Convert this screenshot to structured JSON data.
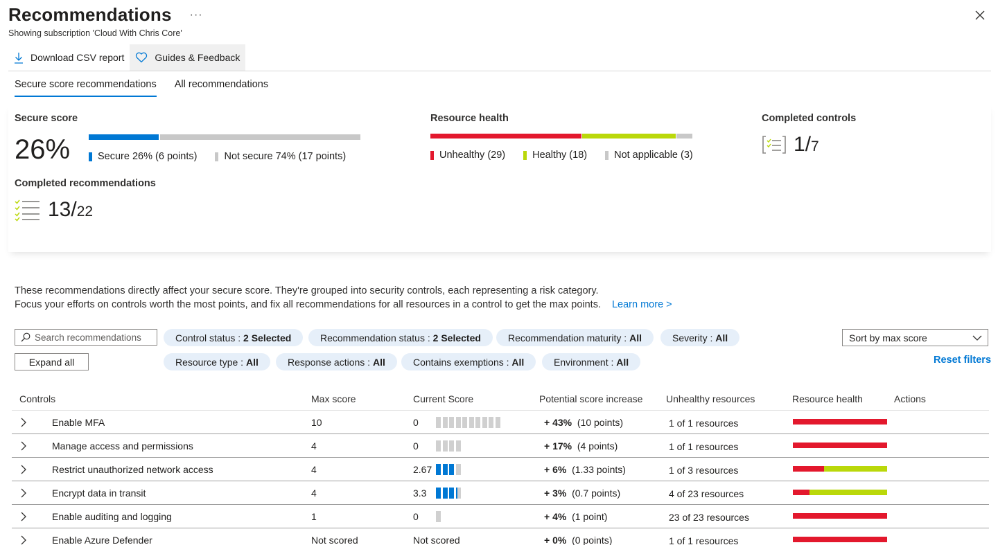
{
  "header": {
    "title": "Recommendations",
    "more": "···",
    "subtitle": "Showing subscription 'Cloud With Chris Core'"
  },
  "toolbar": {
    "download_label": "Download CSV report",
    "guides_label": "Guides & Feedback"
  },
  "tabs": [
    {
      "label": "Secure score recommendations",
      "selected": true
    },
    {
      "label": "All recommendations",
      "selected": false
    }
  ],
  "colors": {
    "accent": "#0078d4",
    "unhealthy": "#e3182d",
    "healthy": "#bad80a",
    "neutral": "#c8c8c8",
    "pill": "#e6eff9"
  },
  "secure_score": {
    "label": "Secure score",
    "value": "26%",
    "secure_fraction": 0.26,
    "secure_label": "Secure 26% (6 points)",
    "not_secure_label": "Not secure 74% (17 points)"
  },
  "resource_health": {
    "label": "Resource health",
    "unhealthy": 29,
    "healthy": 18,
    "not_applicable": 3,
    "unhealthy_label": "Unhealthy (29)",
    "healthy_label": "Healthy (18)",
    "na_label": "Not applicable (3)"
  },
  "completed_controls": {
    "label": "Completed controls",
    "num": "1",
    "den": "7"
  },
  "completed_recommendations": {
    "label": "Completed recommendations",
    "num": "13",
    "den": "22"
  },
  "description": {
    "line1": "These recommendations directly affect your secure score. They're grouped into security controls, each representing a risk category.",
    "line2": "Focus your efforts on controls worth the most points, and fix all recommendations for all resources in a control to get the max points.",
    "learn_more": "Learn more >"
  },
  "filters": {
    "search_placeholder": "Search recommendations",
    "expand_all": "Expand all",
    "sort_value": "Sort by max score",
    "reset": "Reset filters",
    "pills": [
      {
        "key": "Control status : ",
        "value": "2 Selected"
      },
      {
        "key": "Recommendation status : ",
        "value": "2 Selected"
      },
      {
        "key": "Recommendation maturity : ",
        "value": "All"
      },
      {
        "key": "Severity : ",
        "value": "All"
      },
      {
        "key": "Resource type : ",
        "value": "All"
      },
      {
        "key": "Response actions : ",
        "value": "All"
      },
      {
        "key": "Contains exemptions : ",
        "value": "All"
      },
      {
        "key": "Environment : ",
        "value": "All"
      }
    ]
  },
  "table": {
    "columns": [
      "Controls",
      "Max score",
      "Current Score",
      "Potential score increase",
      "Unhealthy resources",
      "Resource health",
      "Actions"
    ],
    "rows": [
      {
        "name": "Enable MFA",
        "max": "10",
        "current": "0",
        "segments": 10,
        "filled": 0,
        "partial": 0,
        "inc_pct": "+ 43%",
        "inc_pts": "(10 points)",
        "unhealthy": "1 of 1 resources",
        "health_unhealthy": 1.0
      },
      {
        "name": "Manage access and permissions",
        "max": "4",
        "current": "0",
        "segments": 4,
        "filled": 0,
        "partial": 0,
        "inc_pct": "+ 17%",
        "inc_pts": "(4 points)",
        "unhealthy": "1 of 1 resources",
        "health_unhealthy": 1.0
      },
      {
        "name": "Restrict unauthorized network access",
        "max": "4",
        "current": "2.67",
        "segments": 4,
        "filled": 3,
        "partial": 0,
        "inc_pct": "+ 6%",
        "inc_pts": "(1.33 points)",
        "unhealthy": "1 of 3 resources",
        "health_unhealthy": 0.333
      },
      {
        "name": "Encrypt data in transit",
        "max": "4",
        "current": "3.3",
        "segments": 4,
        "filled": 3,
        "partial": 0.3,
        "inc_pct": "+ 3%",
        "inc_pts": "(0.7 points)",
        "unhealthy": "4 of 23 resources",
        "health_unhealthy": 0.174
      },
      {
        "name": "Enable auditing and logging",
        "max": "1",
        "current": "0",
        "segments": 1,
        "filled": 0,
        "partial": 0,
        "inc_pct": "+ 4%",
        "inc_pts": "(1 point)",
        "unhealthy": "23 of 23 resources",
        "health_unhealthy": 1.0
      },
      {
        "name": "Enable Azure Defender",
        "max": "Not scored",
        "current": "Not scored",
        "segments": 0,
        "filled": 0,
        "partial": 0,
        "inc_pct": "+ 0%",
        "inc_pts": "(0 points)",
        "unhealthy": "1 of 1 resources",
        "health_unhealthy": 1.0
      }
    ]
  }
}
